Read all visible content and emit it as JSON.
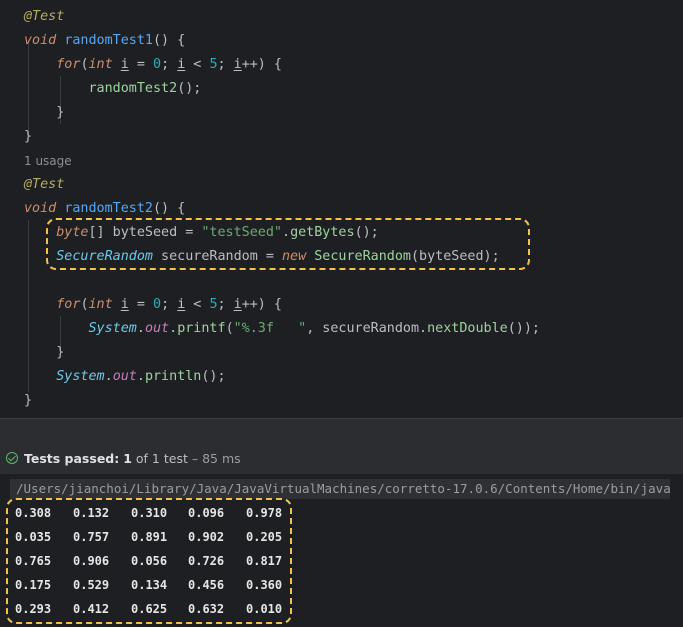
{
  "editor": {
    "lines": [
      {
        "tokens": [
          {
            "t": "@Test",
            "c": "ann"
          }
        ]
      },
      {
        "tokens": [
          {
            "t": "void",
            "c": "kw"
          },
          {
            "t": " "
          },
          {
            "t": "randomTest1",
            "c": "fn"
          },
          {
            "t": "() {"
          }
        ]
      },
      {
        "tokens": [
          {
            "t": "    "
          },
          {
            "t": "for",
            "c": "kw"
          },
          {
            "t": "("
          },
          {
            "t": "int",
            "c": "kw"
          },
          {
            "t": " "
          },
          {
            "t": "i",
            "c": "var"
          },
          {
            "t": " = "
          },
          {
            "t": "0",
            "c": "num"
          },
          {
            "t": "; "
          },
          {
            "t": "i",
            "c": "var"
          },
          {
            "t": " < "
          },
          {
            "t": "5",
            "c": "num"
          },
          {
            "t": "; "
          },
          {
            "t": "i",
            "c": "var"
          },
          {
            "t": "++) {"
          }
        ]
      },
      {
        "tokens": [
          {
            "t": "        "
          },
          {
            "t": "randomTest2",
            "c": "call"
          },
          {
            "t": "();"
          }
        ]
      },
      {
        "tokens": [
          {
            "t": "    }"
          }
        ]
      },
      {
        "tokens": [
          {
            "t": "}"
          }
        ]
      },
      {
        "usage": "1 usage"
      },
      {
        "tokens": [
          {
            "t": "@Test",
            "c": "ann"
          }
        ]
      },
      {
        "tokens": [
          {
            "t": "void",
            "c": "kw"
          },
          {
            "t": " "
          },
          {
            "t": "randomTest2",
            "c": "fn"
          },
          {
            "t": "() {"
          }
        ]
      },
      {
        "tokens": [
          {
            "t": "    "
          },
          {
            "t": "byte",
            "c": "kw"
          },
          {
            "t": "[] byteSeed = "
          },
          {
            "t": "\"testSeed\"",
            "c": "str"
          },
          {
            "t": "."
          },
          {
            "t": "getBytes",
            "c": "call"
          },
          {
            "t": "();"
          }
        ]
      },
      {
        "tokens": [
          {
            "t": "    "
          },
          {
            "t": "SecureRandom",
            "c": "cls"
          },
          {
            "t": " secureRandom = "
          },
          {
            "t": "new",
            "c": "kw"
          },
          {
            "t": " "
          },
          {
            "t": "SecureRandom",
            "c": "call"
          },
          {
            "t": "(byteSeed);"
          }
        ]
      },
      {
        "tokens": []
      },
      {
        "tokens": [
          {
            "t": "    "
          },
          {
            "t": "for",
            "c": "kw"
          },
          {
            "t": "("
          },
          {
            "t": "int",
            "c": "kw"
          },
          {
            "t": " "
          },
          {
            "t": "i",
            "c": "var"
          },
          {
            "t": " = "
          },
          {
            "t": "0",
            "c": "num"
          },
          {
            "t": "; "
          },
          {
            "t": "i",
            "c": "var"
          },
          {
            "t": " < "
          },
          {
            "t": "5",
            "c": "num"
          },
          {
            "t": "; "
          },
          {
            "t": "i",
            "c": "var"
          },
          {
            "t": "++) {"
          }
        ]
      },
      {
        "tokens": [
          {
            "t": "        "
          },
          {
            "t": "System",
            "c": "cls"
          },
          {
            "t": "."
          },
          {
            "t": "out",
            "c": "fld"
          },
          {
            "t": "."
          },
          {
            "t": "printf",
            "c": "call"
          },
          {
            "t": "("
          },
          {
            "t": "\"%.3f   \"",
            "c": "str"
          },
          {
            "t": ", secureRandom."
          },
          {
            "t": "nextDouble",
            "c": "call"
          },
          {
            "t": "());"
          }
        ]
      },
      {
        "tokens": [
          {
            "t": "    }"
          }
        ]
      },
      {
        "tokens": [
          {
            "t": "    "
          },
          {
            "t": "System",
            "c": "cls"
          },
          {
            "t": "."
          },
          {
            "t": "out",
            "c": "fld"
          },
          {
            "t": "."
          },
          {
            "t": "println",
            "c": "call"
          },
          {
            "t": "();"
          }
        ]
      },
      {
        "tokens": [
          {
            "t": "}"
          }
        ]
      }
    ]
  },
  "tests": {
    "label": "Tests passed:",
    "passed": "1",
    "of_text": " of 1 test",
    "duration": " – 85 ms"
  },
  "console": {
    "path": "/Users/jianchoi/Library/Java/JavaVirtualMachines/corretto-17.0.6/Contents/Home/bin/java ...",
    "output": [
      [
        "0.308",
        "0.132",
        "0.310",
        "0.096",
        "0.978"
      ],
      [
        "0.035",
        "0.757",
        "0.891",
        "0.902",
        "0.205"
      ],
      [
        "0.765",
        "0.906",
        "0.056",
        "0.726",
        "0.817"
      ],
      [
        "0.175",
        "0.529",
        "0.134",
        "0.456",
        "0.360"
      ],
      [
        "0.293",
        "0.412",
        "0.625",
        "0.632",
        "0.010"
      ]
    ]
  },
  "colors": {
    "highlight_dash": "#f2c14e",
    "pass_green": "#5fb865"
  }
}
